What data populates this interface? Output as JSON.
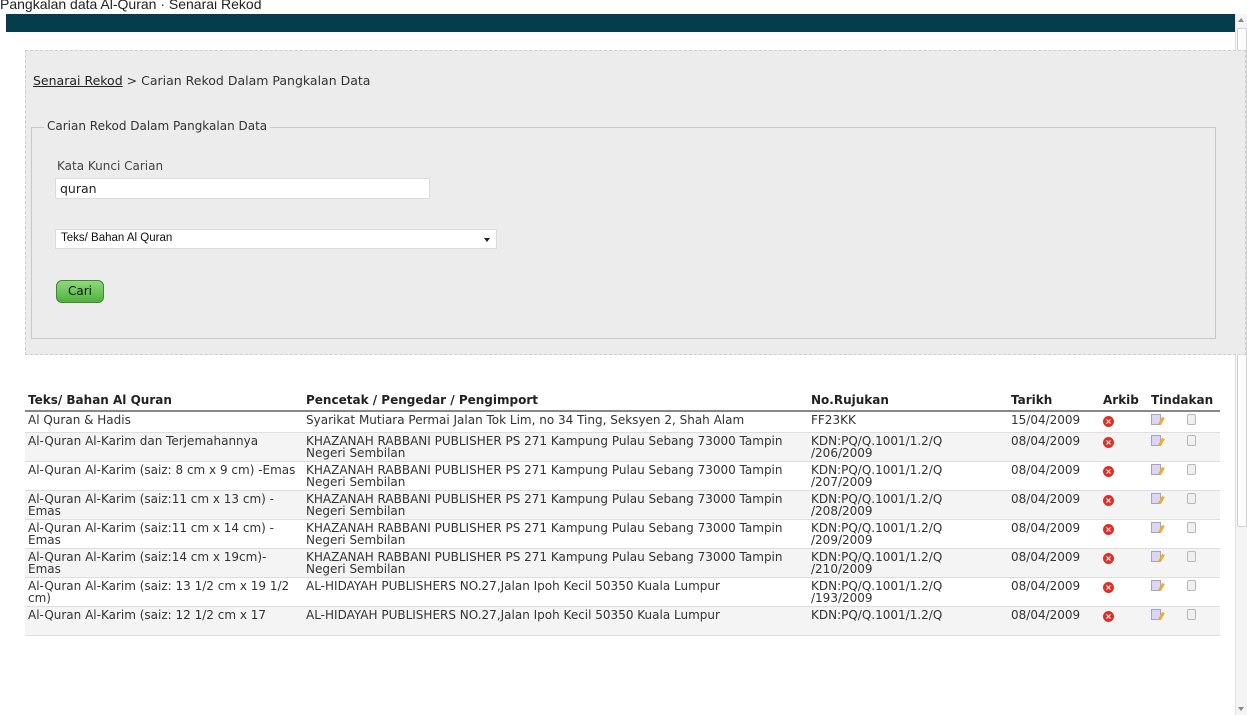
{
  "page_top_text": "Pangkalan data Al-Quran · Senarai Rekod",
  "breadcrumb": {
    "link": "Senarai Rekod",
    "separator": ">",
    "current": "Carian Rekod Dalam Pangkalan Data"
  },
  "search": {
    "legend": "Carian Rekod Dalam Pangkalan Data",
    "keyword_label": "Kata Kunci Carian",
    "keyword_value": "quran",
    "category_selected": "Teks/ Bahan Al Quran",
    "submit_label": "Cari"
  },
  "table": {
    "headers": [
      "Teks/ Bahan Al Quran",
      "Pencetak / Pengedar / Pengimport",
      "No.Rujukan",
      "Tarikh",
      "Arkib",
      "Tindakan"
    ],
    "rows": [
      {
        "title": "Al Quran & Hadis",
        "publisher": "Syarikat Mutiara Permai Jalan Tok Lim, no 34 Ting, Seksyen 2, Shah Alam",
        "ref": "FF23KK",
        "date": "15/04/2009"
      },
      {
        "title": "Al-Quran Al-Karim dan Terjemahannya",
        "publisher": "KHAZANAH RABBANI PUBLISHER PS 271 Kampung Pulau Sebang 73000 Tampin Negeri Sembilan",
        "ref": "KDN:PQ/Q.1001/1.2/Q /206/2009",
        "date": "08/04/2009"
      },
      {
        "title": "Al-Quran Al-Karim (saiz: 8 cm x 9 cm) -Emas",
        "publisher": "KHAZANAH RABBANI PUBLISHER PS 271 Kampung Pulau Sebang 73000 Tampin Negeri Sembilan",
        "ref": "KDN:PQ/Q.1001/1.2/Q /207/2009",
        "date": "08/04/2009"
      },
      {
        "title": "Al-Quran Al-Karim (saiz:11 cm x 13 cm) -Emas",
        "publisher": "KHAZANAH RABBANI PUBLISHER PS 271 Kampung Pulau Sebang 73000 Tampin Negeri Sembilan",
        "ref": "KDN:PQ/Q.1001/1.2/Q /208/2009",
        "date": "08/04/2009"
      },
      {
        "title": "Al-Quran Al-Karim (saiz:11 cm x 14 cm) -Emas",
        "publisher": "KHAZANAH RABBANI PUBLISHER PS 271 Kampung Pulau Sebang 73000 Tampin Negeri Sembilan",
        "ref": "KDN:PQ/Q.1001/1.2/Q /209/2009",
        "date": "08/04/2009"
      },
      {
        "title": "Al-Quran Al-Karim (saiz:14 cm x 19cm)-Emas",
        "publisher": "KHAZANAH RABBANI PUBLISHER PS 271 Kampung Pulau Sebang 73000 Tampin Negeri Sembilan",
        "ref": "KDN:PQ/Q.1001/1.2/Q /210/2009",
        "date": "08/04/2009"
      },
      {
        "title": "Al-Quran Al-Karim (saiz: 13 1/2 cm x 19 1/2 cm)",
        "publisher": "AL-HIDAYAH PUBLISHERS NO.27,Jalan Ipoh Kecil 50350 Kuala Lumpur",
        "ref": "KDN:PQ/Q.1001/1.2/Q /193/2009",
        "date": "08/04/2009"
      },
      {
        "title": "Al-Quran Al-Karim (saiz: 12 1/2 cm x 17",
        "publisher": "AL-HIDAYAH PUBLISHERS NO.27,Jalan Ipoh Kecil 50350 Kuala Lumpur",
        "ref": "KDN:PQ/Q.1001/1.2/Q",
        "date": "08/04/2009"
      }
    ]
  },
  "icons": {
    "archive": "delete-x-icon",
    "edit": "edit-icon",
    "record": "record-icon"
  },
  "colors": {
    "header_bar": "#063d4c",
    "panel_bg": "#ececec",
    "button_green": "#5cbf49",
    "delete_red": "#d8322b"
  }
}
